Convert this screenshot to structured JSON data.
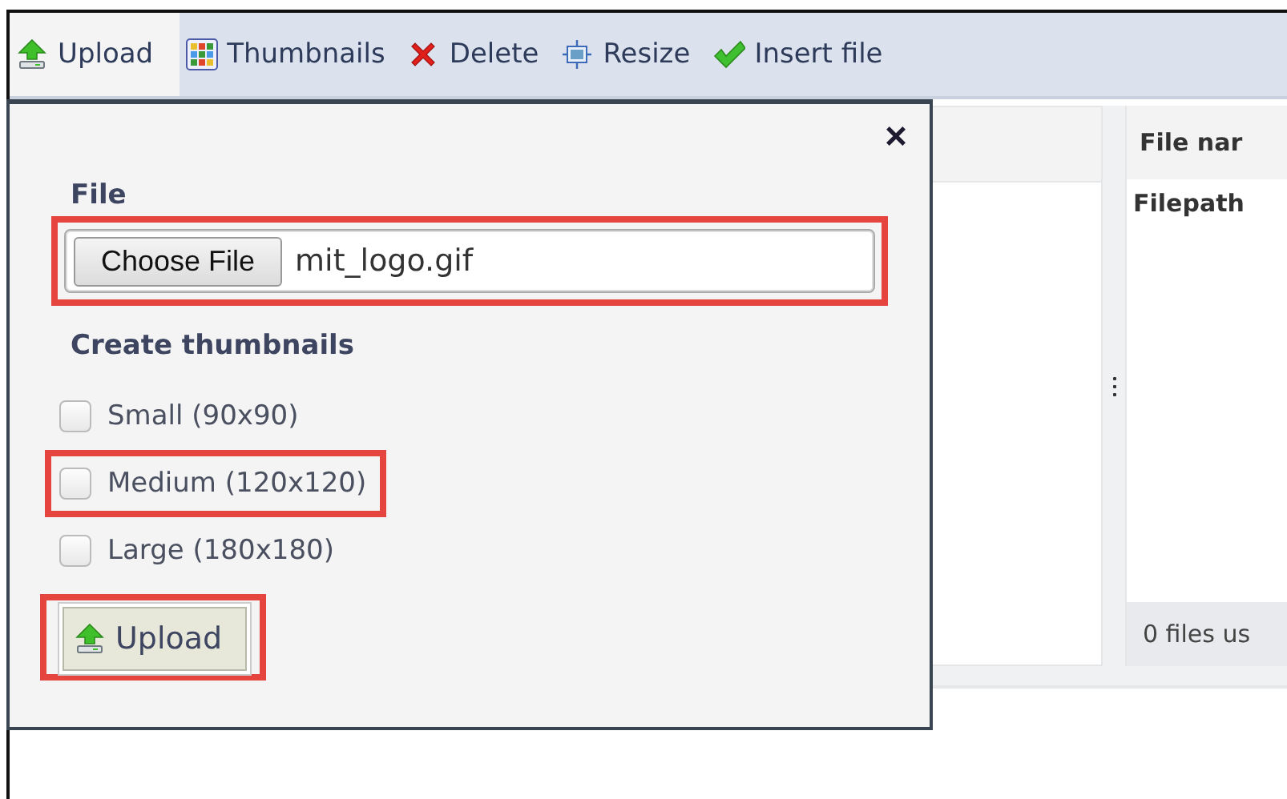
{
  "toolbar": [
    {
      "label": "Upload",
      "kind": "upload",
      "selected": true
    },
    {
      "label": "Thumbnails",
      "kind": "thumbnails",
      "selected": false
    },
    {
      "label": "Delete",
      "kind": "delete",
      "selected": false
    },
    {
      "label": "Resize",
      "kind": "resize",
      "selected": false
    },
    {
      "label": "Insert file",
      "kind": "insert",
      "selected": false
    }
  ],
  "upload_panel": {
    "close": "×",
    "file_label": "File",
    "file_button": "Choose File",
    "file_value": "mit_logo.gif",
    "file_highlighted": true,
    "thumbnails_label": "Create thumbnails",
    "options": [
      {
        "label": "Small (90x90)",
        "checked": false,
        "highlighted": false
      },
      {
        "label": "Medium (120x120)",
        "checked": false,
        "highlighted": true
      },
      {
        "label": "Large (180x180)",
        "checked": false,
        "highlighted": false
      }
    ],
    "upload_button": "Upload",
    "upload_highlighted": true
  },
  "file_list": {
    "column_header": "File nar",
    "row": "Filepath",
    "footer": "0 files us"
  }
}
